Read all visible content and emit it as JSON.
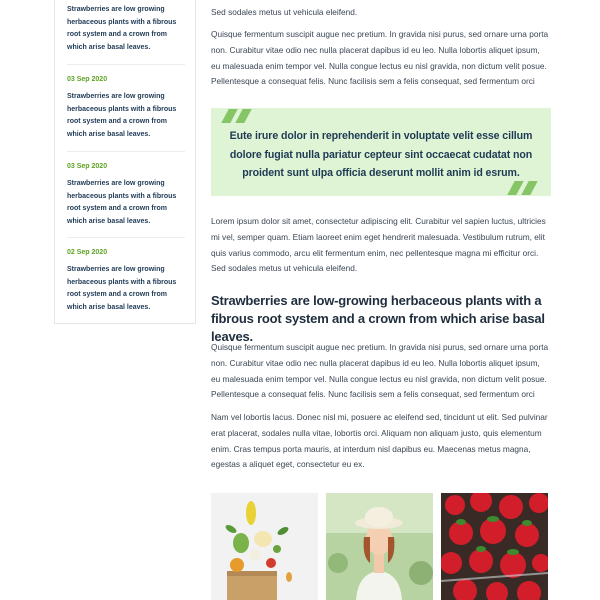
{
  "sidebar": {
    "posts": [
      {
        "date": "",
        "text": "Strawberries are low growing herbaceous plants with a fibrous root system and a crown from which arise basal leaves."
      },
      {
        "date": "03 Sep 2020",
        "text": "Strawberries are low growing herbaceous plants with a fibrous root system and a crown from which arise basal leaves."
      },
      {
        "date": "03 Sep 2020",
        "text": "Strawberries are low growing herbaceous plants with a fibrous root system and a crown from which arise basal leaves."
      },
      {
        "date": "02 Sep 2020",
        "text": "Strawberries are low growing herbaceous plants with a fibrous root system and a crown from which arise basal leaves."
      }
    ]
  },
  "article": {
    "top_fragment": "Sed sodales metus ut vehicula eleifend.",
    "para1": "Quisque fermentum suscipit augue nec pretium. In gravida nisi purus, sed ornare urna porta non. Curabitur vitae odio nec nulla placerat dapibus id eu leo. Nulla lobortis aliquet ipsum, eu malesuada enim tempor vel. Nulla congue lectus eu nisl gravida, non dictum velit posue. Pellentesque a consequat felis. Nunc facilisis sem a felis consequat, sed fermentum orci",
    "quote": "Eute irure dolor in reprehenderit in voluptate velit esse cillum dolore fugiat nulla pariatur cepteur sint occaecat cudatat non proident sunt ulpa officia deserunt mollit anim id esrum.",
    "para2": "Lorem ipsum dolor sit amet, consectetur adipiscing elit. Curabitur vel sapien luctus, ultricies mi vel, semper quam. Etiam laoreet enim eget hendrerit malesuada. Vestibulum rutrum, elit quis varius commodo, arcu elit fermentum enim, nec pellentesque magna mi efficitur orci. Sed sodales metus ut vehicula eleifend.",
    "heading": "Strawberries are low-growing herbaceous plants with a fibrous root system and a crown from which arise basal leaves.",
    "para3": "Quisque fermentum suscipit augue nec pretium. In gravida nisi purus, sed ornare urna porta non. Curabitur vitae odio nec nulla placerat dapibus id eu leo. Nulla lobortis aliquet ipsum, eu malesuada enim tempor vel. Nulla congue lectus eu nisl gravida, non dictum velit posue. Pellentesque a consequat felis. Nunc facilisis sem a felis consequat, sed fermentum orci",
    "para4": "Nam vel lobortis lacus. Donec nisl mi, posuere ac eleifend sed, tincidunt ut elit. Sed pulvinar erat placerat, sodales nulla vitae, lobortis orci. Aliquam non aliquam justo, quis elementum enim. Cras tempus porta mauris, at interdum nisl dapibus eu. Maecenas metus magna, egestas a aliquet eget, consectetur eu ex."
  },
  "colors": {
    "accent_green": "#5ea324",
    "quote_background": "#def4d4",
    "quote_mark": "#86c565",
    "heading_navy": "#1f2d3d"
  }
}
